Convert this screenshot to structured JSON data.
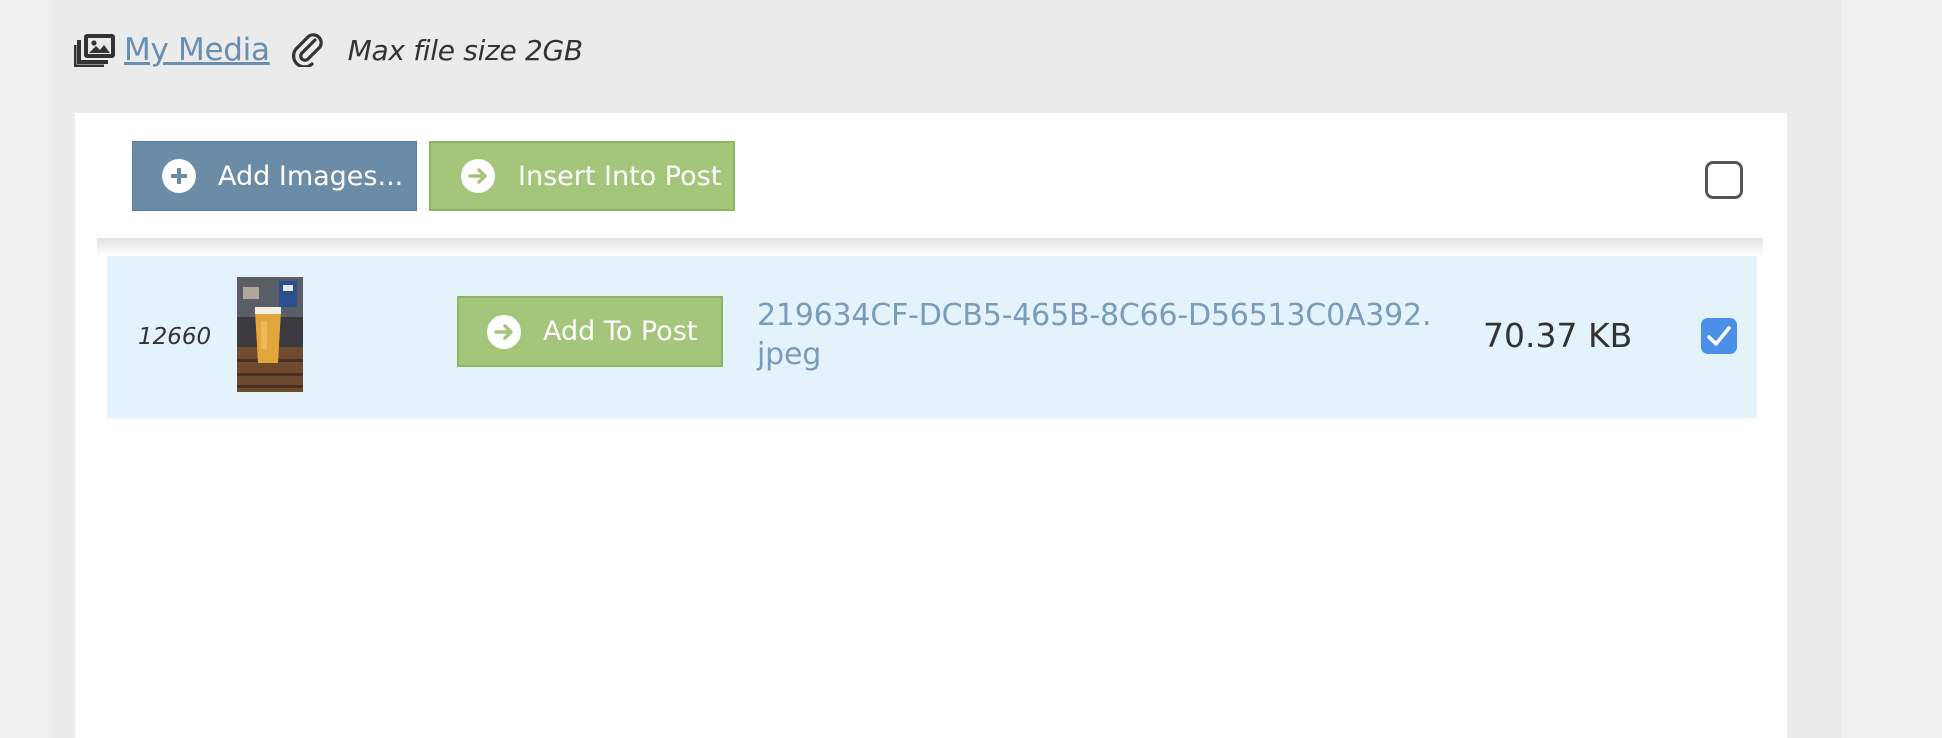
{
  "header": {
    "media_link": "My Media",
    "max_size": "Max file size 2GB"
  },
  "toolbar": {
    "add_images_label": "Add Images...",
    "insert_label": "Insert Into Post",
    "select_all_checked": false
  },
  "files": [
    {
      "id": "12660",
      "add_label": "Add To Post",
      "name": "219634CF-DCB5-465B-8C66-D56513C0A392.jpeg",
      "size": "70.37 KB",
      "checked": true
    }
  ],
  "colors": {
    "link": "#6a8fae",
    "primary_button": "#6a8ca6",
    "success_button": "#a3c67a",
    "row_highlight": "#e4f2fb",
    "checkbox_checked": "#4a8fe8"
  },
  "icons": {
    "media": "photo-stack-icon",
    "attachment": "paperclip-icon",
    "add": "plus-circle-icon",
    "insert": "arrow-right-circle-icon",
    "check": "checkmark-icon"
  }
}
